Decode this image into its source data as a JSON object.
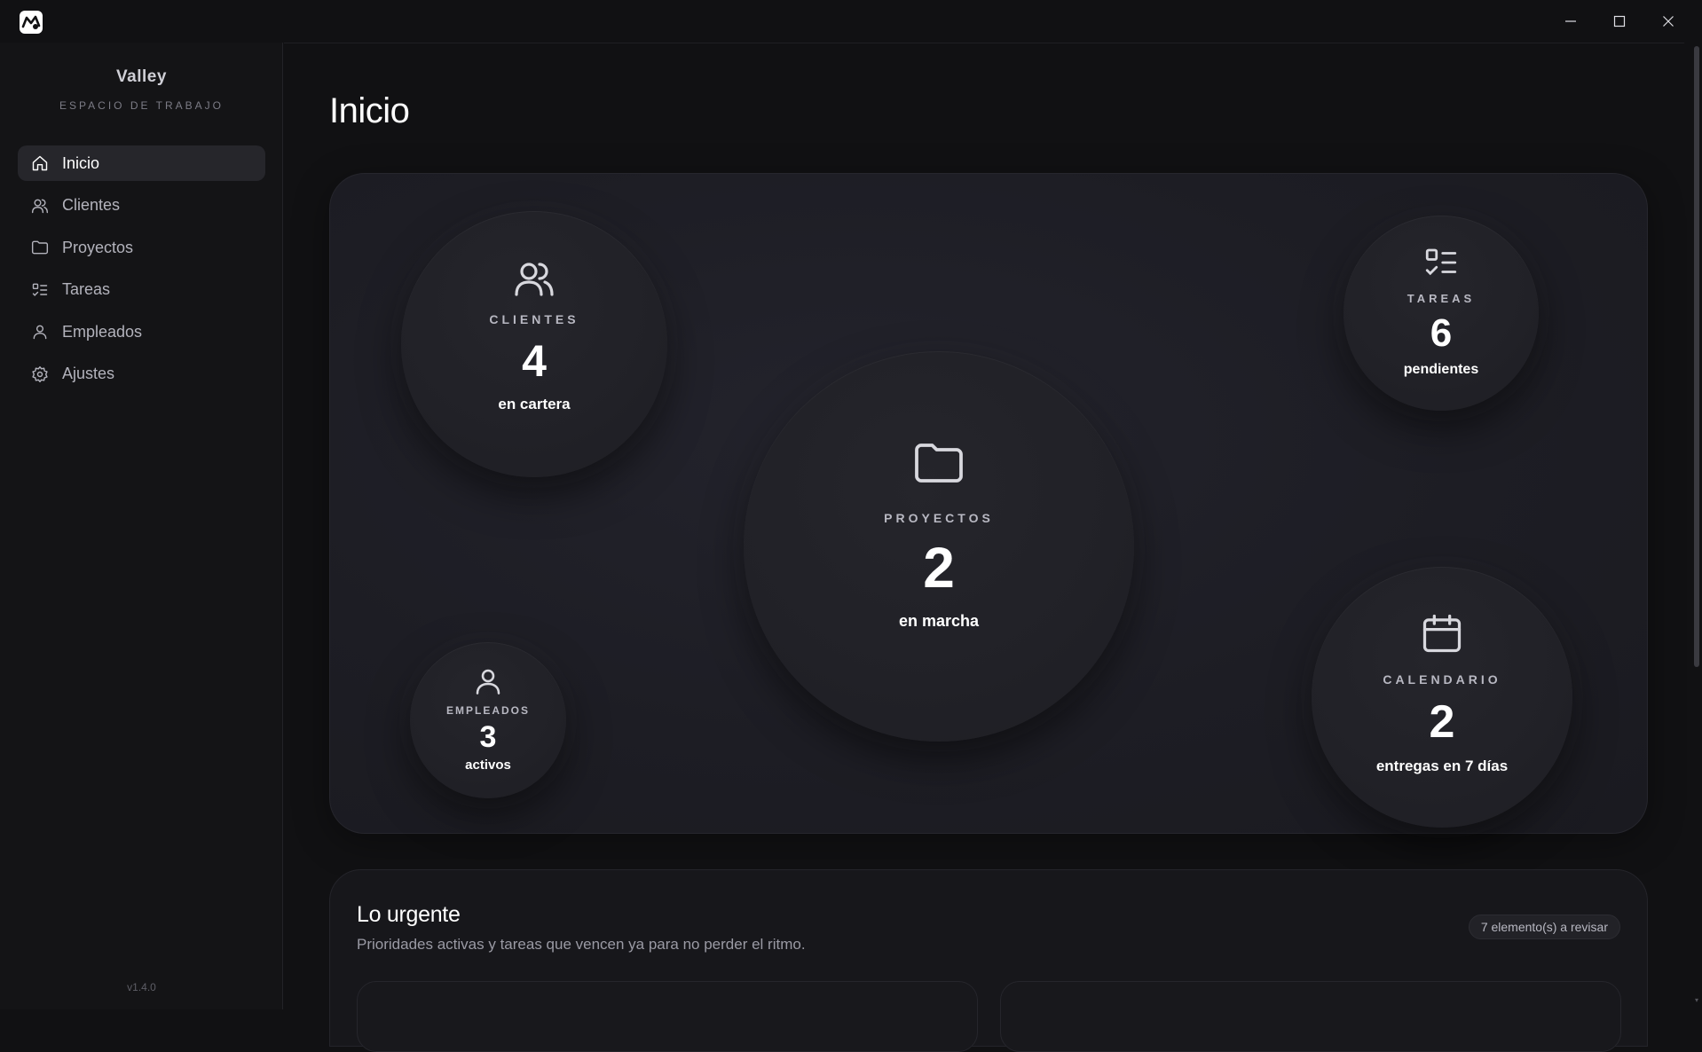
{
  "window": {
    "logo_icon": "app-logo-icon",
    "controls": [
      "minimize-icon",
      "maximize-icon",
      "close-icon"
    ]
  },
  "sidebar": {
    "brand": "Valley",
    "brand_sub": "ESPACIO DE TRABAJO",
    "items": [
      {
        "label": "Inicio",
        "icon": "home-icon",
        "active": true
      },
      {
        "label": "Clientes",
        "icon": "users-icon",
        "active": false
      },
      {
        "label": "Proyectos",
        "icon": "folder-icon",
        "active": false
      },
      {
        "label": "Tareas",
        "icon": "checklist-icon",
        "active": false
      },
      {
        "label": "Empleados",
        "icon": "user-icon",
        "active": false
      },
      {
        "label": "Ajustes",
        "icon": "gear-icon",
        "active": false
      }
    ],
    "version": "v1.4.0"
  },
  "main": {
    "title": "Inicio",
    "stats": {
      "clientes": {
        "label": "CLIENTES",
        "value": "4",
        "sub": "en cartera",
        "icon": "users-icon"
      },
      "proyectos": {
        "label": "PROYECTOS",
        "value": "2",
        "sub": "en marcha",
        "icon": "folder-icon"
      },
      "tareas": {
        "label": "TAREAS",
        "value": "6",
        "sub": "pendientes",
        "icon": "checklist-icon"
      },
      "calendario": {
        "label": "CALENDARIO",
        "value": "2",
        "sub": "entregas en 7 días",
        "icon": "calendar-icon"
      },
      "empleados": {
        "label": "EMPLEADOS",
        "value": "3",
        "sub": "activos",
        "icon": "user-icon"
      }
    },
    "urgent": {
      "title": "Lo urgente",
      "subtitle": "Prioridades activas y tareas que vencen ya para no perder el ritmo.",
      "badge": "7 elemento(s) a revisar"
    }
  },
  "colors": {
    "background": "#111113",
    "sidebar": "#141416",
    "active_item": "#26262b",
    "panel": "#1d1d24",
    "text": "#ffffff",
    "muted": "#9a9aa4"
  }
}
